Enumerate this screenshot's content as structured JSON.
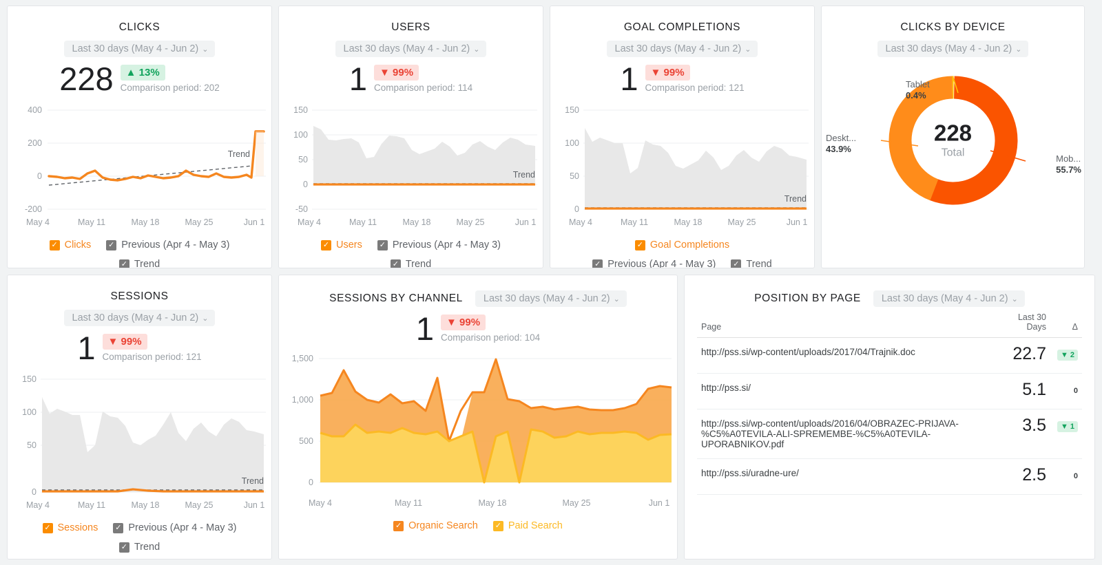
{
  "colors": {
    "orange": "#f5861f",
    "orange_strong": "#fb8c00",
    "mobile": "#fa5400",
    "desktop": "#ff8c1a",
    "tablet": "#ffc107",
    "paid": "#ffd24d",
    "organic": "#f79434",
    "grey": "#7a7a7a",
    "up": "#12a35d",
    "down": "#ea4335"
  },
  "date_range_label": "Last 30 days (May 4 - Jun 2)",
  "chevron": "⌄",
  "check": "✓",
  "cards": {
    "clicks": {
      "title": "CLICKS",
      "value": "228",
      "badge": "▲ 13%",
      "badge_dir": "up",
      "comparison": "Comparison period: 202",
      "trend_label": "Trend",
      "legend": [
        {
          "label": "Clicks",
          "color": "orange"
        },
        {
          "label": "Previous (Apr 4 - May 3)",
          "color": "grey"
        },
        {
          "label": "Trend",
          "color": "grey"
        }
      ]
    },
    "users": {
      "title": "USERS",
      "value": "1",
      "badge": "▼ 99%",
      "badge_dir": "down",
      "comparison": "Comparison period: 114",
      "trend_label": "Trend",
      "legend": [
        {
          "label": "Users",
          "color": "orange"
        },
        {
          "label": "Previous (Apr 4 - May 3)",
          "color": "grey"
        },
        {
          "label": "Trend",
          "color": "grey"
        }
      ]
    },
    "goal_completions": {
      "title": "GOAL COMPLETIONS",
      "value": "1",
      "badge": "▼ 99%",
      "badge_dir": "down",
      "comparison": "Comparison period: 121",
      "trend_label": "Trend",
      "legend": [
        {
          "label": "Goal Completions",
          "color": "orange"
        },
        {
          "label": "Previous (Apr 4 - May 3)",
          "color": "grey"
        },
        {
          "label": "Trend",
          "color": "grey"
        }
      ]
    },
    "clicks_by_device": {
      "title": "CLICKS BY DEVICE",
      "total_value": "228",
      "total_label": "Total",
      "slices": [
        {
          "name": "Tablet",
          "pct": "0.4%"
        },
        {
          "name": "Deskt...",
          "pct": "43.9%"
        },
        {
          "name": "Mob...",
          "pct": "55.7%"
        }
      ]
    },
    "sessions": {
      "title": "SESSIONS",
      "value": "1",
      "badge": "▼ 99%",
      "badge_dir": "down",
      "comparison": "Comparison period: 121",
      "trend_label": "Trend",
      "legend": [
        {
          "label": "Sessions",
          "color": "orange"
        },
        {
          "label": "Previous (Apr 4 - May 3)",
          "color": "grey"
        },
        {
          "label": "Trend",
          "color": "grey"
        }
      ]
    },
    "sessions_by_channel": {
      "title": "SESSIONS BY CHANNEL",
      "value": "1",
      "badge": "▼ 99%",
      "badge_dir": "down",
      "comparison": "Comparison period: 104",
      "legend": [
        {
          "label": "Organic Search",
          "color": "organic"
        },
        {
          "label": "Paid Search",
          "color": "paid"
        }
      ]
    },
    "position_by_page": {
      "title": "POSITION BY PAGE",
      "columns": [
        "Page",
        "Last 30\nDays",
        "Δ"
      ],
      "col_page": "Page",
      "col_value_l1": "Last 30",
      "col_value_l2": "Days",
      "col_delta": "Δ",
      "rows": [
        {
          "page": "http://pss.si/wp-content/uploads/2017/04/Trajnik.doc",
          "value": "22.7",
          "delta": "▼ 2",
          "delta_type": "badge"
        },
        {
          "page": "http://pss.si/",
          "value": "5.1",
          "delta": "0",
          "delta_type": "zero"
        },
        {
          "page": "http://pss.si/wp-content/uploads/2016/04/OBRAZEC-PRIJAVA-%C5%A0TEVILA-ALI-SPREMEMBE-%C5%A0TEVILA-UPORABNIKOV.pdf",
          "value": "3.5",
          "delta": "▼ 1",
          "delta_type": "badge"
        },
        {
          "page": "http://pss.si/uradne-ure/",
          "value": "2.5",
          "delta": "0",
          "delta_type": "zero"
        }
      ]
    }
  },
  "chart_data": [
    {
      "type": "line",
      "name": "clicks",
      "title": "CLICKS",
      "xlabel": "",
      "ylabel": "",
      "x_ticks": [
        "May 4",
        "May 11",
        "May 18",
        "May 25",
        "Jun 1"
      ],
      "y_ticks": [
        400,
        200,
        0,
        -200
      ],
      "ylim": [
        -200,
        400
      ],
      "grid": true,
      "legend_position": "bottom",
      "series": [
        {
          "name": "Clicks",
          "color": "#f5861f",
          "style": "solid",
          "values": [
            18,
            16,
            12,
            14,
            10,
            22,
            30,
            14,
            8,
            6,
            10,
            14,
            12,
            18,
            16,
            12,
            14,
            16,
            30,
            20,
            18,
            16,
            22,
            16,
            14,
            16,
            20,
            14,
            280,
            278
          ]
        },
        {
          "name": "Previous (Apr 4 - May 3)",
          "color": "#cfcfcf",
          "style": "solid",
          "values": [
            10,
            10,
            10,
            10,
            10,
            10,
            10,
            10,
            10,
            10,
            10,
            10,
            10,
            10,
            10,
            10,
            10,
            10,
            10,
            10,
            10,
            10,
            10,
            10,
            10,
            10,
            10,
            10,
            10,
            10
          ]
        },
        {
          "name": "Trend",
          "color": "#5f6368",
          "style": "dashed",
          "values": [
            -24,
            -21,
            -18,
            -15,
            -12,
            -9,
            -6,
            -3,
            0,
            3,
            6,
            9,
            12,
            16,
            19,
            22,
            25,
            28,
            31,
            34,
            37,
            41,
            44,
            47,
            50,
            53,
            56,
            59,
            62,
            66
          ]
        }
      ]
    },
    {
      "type": "area",
      "name": "users",
      "title": "USERS",
      "x_ticks": [
        "May 4",
        "May 11",
        "May 18",
        "May 25",
        "Jun 1"
      ],
      "y_ticks": [
        150,
        100,
        50,
        0,
        -50
      ],
      "ylim": [
        -50,
        150
      ],
      "grid": true,
      "legend_position": "bottom",
      "series": [
        {
          "name": "Previous (Apr 4 - May 3)",
          "color": "#e8e8e8",
          "style": "area",
          "values": [
            118,
            96,
            94,
            96,
            98,
            88,
            54,
            58,
            82,
            95,
            94,
            90,
            70,
            62,
            66,
            72,
            86,
            76,
            58,
            64,
            80,
            88,
            76,
            70,
            86,
            94,
            90,
            80,
            78,
            74
          ]
        },
        {
          "name": "Users",
          "color": "#f5861f",
          "style": "solid",
          "values": [
            1,
            1,
            1,
            1,
            1,
            1,
            1,
            1,
            1,
            1,
            1,
            1,
            1,
            1,
            1,
            1,
            1,
            1,
            1,
            1,
            1,
            1,
            1,
            1,
            1,
            1,
            1,
            1,
            1,
            1
          ]
        },
        {
          "name": "Trend",
          "color": "#5f6368",
          "style": "dashed",
          "values": [
            2,
            2,
            2,
            2,
            2,
            2,
            2,
            2,
            2,
            2,
            2,
            2,
            2,
            2,
            2,
            2,
            2,
            2,
            2,
            2,
            2,
            2,
            2,
            2,
            2,
            2,
            2,
            2,
            2,
            2
          ]
        }
      ]
    },
    {
      "type": "area",
      "name": "goal_completions",
      "title": "GOAL COMPLETIONS",
      "x_ticks": [
        "May 4",
        "May 11",
        "May 18",
        "May 25",
        "Jun 1"
      ],
      "y_ticks": [
        150,
        100,
        50,
        0
      ],
      "ylim": [
        0,
        150
      ],
      "grid": true,
      "legend_position": "bottom",
      "series": [
        {
          "name": "Previous (Apr 4 - May 3)",
          "color": "#e8e8e8",
          "style": "area",
          "values": [
            122,
            102,
            108,
            104,
            100,
            100,
            56,
            62,
            104,
            98,
            96,
            86,
            66,
            62,
            68,
            74,
            88,
            78,
            60,
            66,
            82,
            90,
            78,
            72,
            88,
            96,
            92,
            82,
            80,
            76
          ]
        },
        {
          "name": "Goal Completions",
          "color": "#f5861f",
          "style": "solid",
          "values": [
            1,
            1,
            1,
            1,
            1,
            1,
            1,
            1,
            1,
            1,
            1,
            1,
            1,
            1,
            1,
            1,
            1,
            1,
            1,
            1,
            1,
            1,
            1,
            1,
            1,
            1,
            1,
            1,
            1,
            1
          ]
        },
        {
          "name": "Trend",
          "color": "#5f6368",
          "style": "dashed",
          "values": [
            3,
            3,
            3,
            3,
            3,
            3,
            3,
            3,
            3,
            3,
            3,
            3,
            3,
            3,
            3,
            3,
            3,
            3,
            3,
            3,
            3,
            3,
            3,
            3,
            3,
            3,
            3,
            3,
            3,
            3
          ]
        }
      ]
    },
    {
      "type": "pie",
      "name": "clicks_by_device",
      "title": "CLICKS BY DEVICE",
      "labels": [
        "Mobile",
        "Desktop",
        "Tablet"
      ],
      "values": [
        55.7,
        43.9,
        0.4
      ],
      "colors": [
        "#fa5400",
        "#ff8c1a",
        "#ffc107"
      ],
      "total": 228,
      "total_label": "Total",
      "donut": true
    },
    {
      "type": "area",
      "name": "sessions",
      "title": "SESSIONS",
      "x_ticks": [
        "May 4",
        "May 11",
        "May 18",
        "May 25",
        "Jun 1"
      ],
      "y_ticks": [
        150,
        100,
        50,
        0
      ],
      "ylim": [
        0,
        150
      ],
      "grid": true,
      "legend_position": "bottom",
      "series": [
        {
          "name": "Previous (Apr 4 - May 3)",
          "color": "#e8e8e8",
          "style": "area",
          "values": [
            122,
            102,
            108,
            104,
            100,
            100,
            56,
            62,
            104,
            98,
            96,
            86,
            66,
            62,
            68,
            74,
            88,
            102,
            76,
            66,
            82,
            90,
            78,
            72,
            88,
            96,
            92,
            82,
            80,
            76
          ]
        },
        {
          "name": "Sessions",
          "color": "#f5861f",
          "style": "solid",
          "values": [
            2,
            2,
            2,
            2,
            2,
            2,
            2,
            2,
            2,
            2,
            2,
            2,
            2,
            3,
            4,
            3,
            2,
            2,
            2,
            2,
            2,
            2,
            2,
            2,
            2,
            2,
            2,
            2,
            2,
            2
          ]
        },
        {
          "name": "Trend",
          "color": "#5f6368",
          "style": "dashed",
          "values": [
            2,
            2,
            2,
            2,
            2,
            2,
            2,
            2,
            2,
            2,
            2,
            2,
            2,
            2,
            2,
            2,
            2,
            2,
            2,
            2,
            2,
            2,
            2,
            2,
            2,
            2,
            2,
            2,
            2,
            2
          ]
        }
      ]
    },
    {
      "type": "area",
      "name": "sessions_by_channel",
      "title": "SESSIONS BY CHANNEL",
      "stacked": true,
      "x_ticks": [
        "May 4",
        "May 11",
        "May 18",
        "May 25",
        "Jun 1"
      ],
      "y_ticks": [
        "1,500",
        "1,000",
        "500",
        "0"
      ],
      "ylim": [
        0,
        1500
      ],
      "grid": true,
      "legend_position": "bottom",
      "series": [
        {
          "name": "Paid Search",
          "color": "#ffd24d",
          "values": [
            600,
            560,
            560,
            700,
            600,
            620,
            600,
            660,
            600,
            580,
            620,
            500,
            560,
            620,
            0,
            560,
            620,
            0,
            640,
            620,
            540,
            560,
            620,
            580,
            600,
            600,
            620,
            600,
            520,
            580
          ]
        },
        {
          "name": "Organic Search",
          "color": "#f79434",
          "values": [
            450,
            480,
            800,
            600,
            500,
            450,
            620,
            450,
            520,
            420,
            780,
            0,
            520,
            460,
            1050,
            420,
            320,
            1100,
            380,
            340,
            420,
            400,
            360,
            400,
            420,
            360,
            360,
            420,
            560,
            620
          ]
        }
      ]
    }
  ]
}
